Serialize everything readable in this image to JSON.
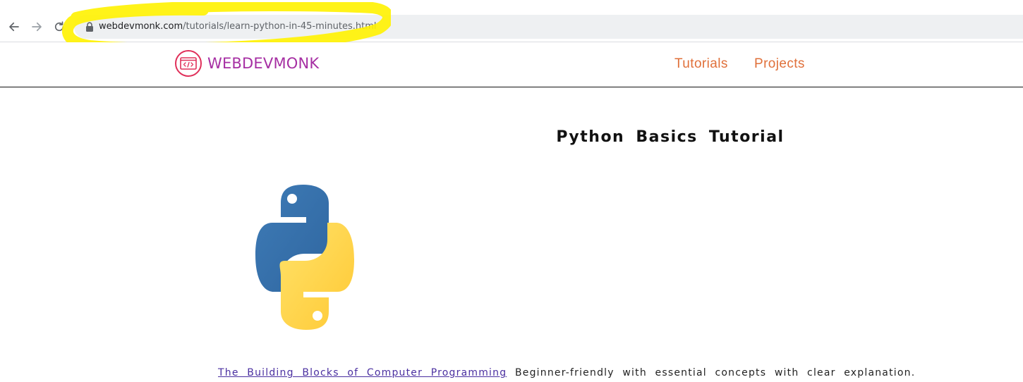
{
  "browser": {
    "url_domain": "webdevmonk.com",
    "url_path": "/tutorials/learn-python-in-45-minutes.html"
  },
  "header": {
    "logo_text": "WEBDEVMONK",
    "nav": [
      {
        "label": "Tutorials"
      },
      {
        "label": "Projects"
      }
    ]
  },
  "hero": {
    "title": "Python Basics Tutorial",
    "description_link": "The Building Blocks of Computer Programming",
    "description_text": " Beginner-friendly with essential concepts with clear explanation."
  },
  "colors": {
    "brand": "#a62fa3",
    "nav_link": "#e0703a",
    "highlight": "#fff200",
    "python_blue": "#3a74ab",
    "python_yellow": "#ffd23c"
  },
  "icons": [
    "back-arrow-icon",
    "forward-arrow-icon",
    "reload-icon",
    "lock-icon",
    "code-logo-icon",
    "python-logo-icon"
  ]
}
